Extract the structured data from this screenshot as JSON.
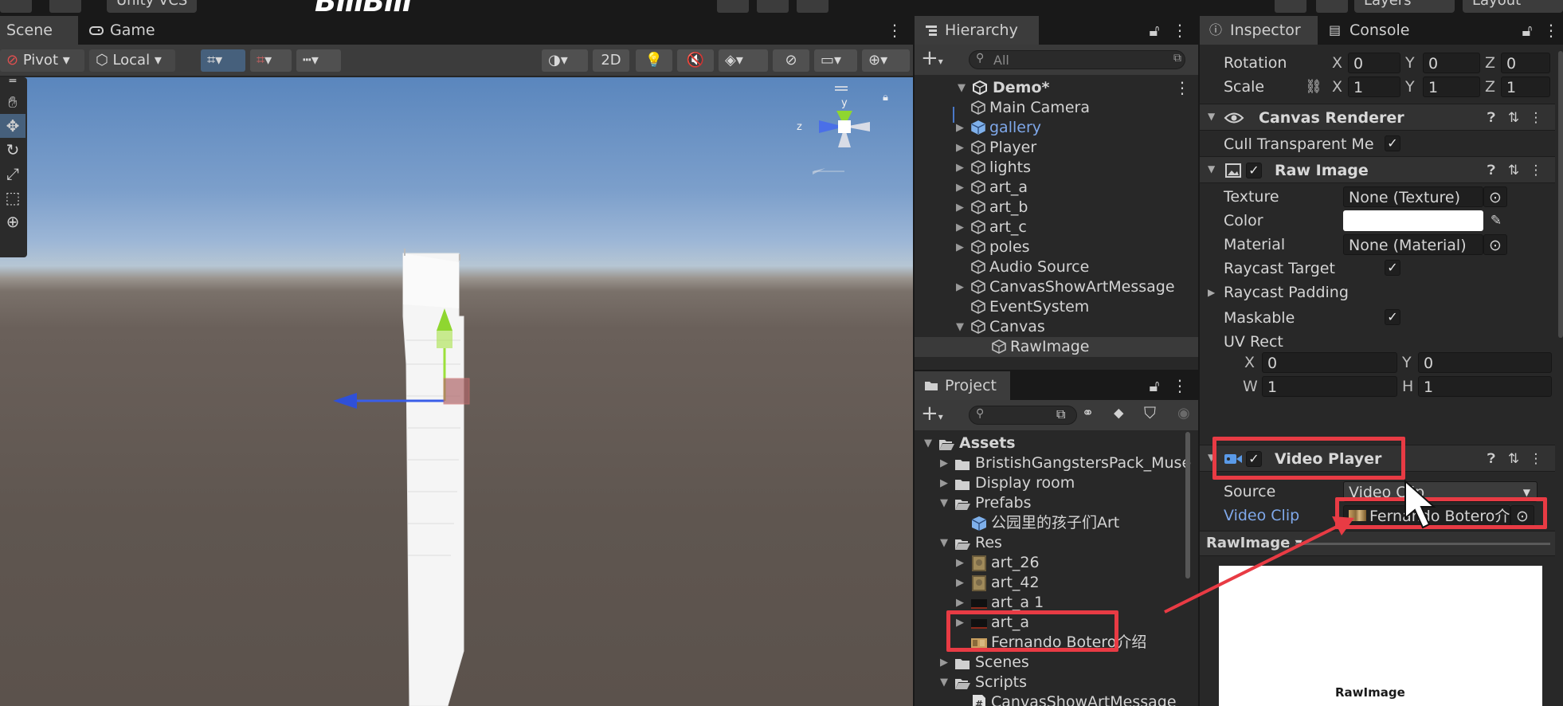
{
  "top_toolbar": {
    "vcs_label": "Unity VCS",
    "watermark": "BiliBili",
    "layers_label": "Layers",
    "layout_label": "Layout"
  },
  "scene": {
    "tabs": [
      {
        "label": "Scene",
        "icon": "grid-icon",
        "active": true
      },
      {
        "label": "Game",
        "icon": "gamepad-icon",
        "active": false
      }
    ],
    "toolbar": {
      "pivot_label": "Pivot",
      "local_label": "Local",
      "two_d_label": "2D"
    },
    "gizmo_axes": {
      "y": "y",
      "z": "z"
    }
  },
  "hierarchy": {
    "tab_label": "Hierarchy",
    "search_placeholder": "All",
    "root": "Demo*",
    "items": [
      {
        "label": "Main Camera",
        "depth": 1,
        "expandable": false,
        "selected": false,
        "prefab": false
      },
      {
        "label": "gallery",
        "depth": 1,
        "expandable": true,
        "selected": false,
        "prefab": true
      },
      {
        "label": "Player",
        "depth": 1,
        "expandable": true,
        "selected": false,
        "prefab": false
      },
      {
        "label": "lights",
        "depth": 1,
        "expandable": true,
        "selected": false,
        "prefab": false
      },
      {
        "label": "art_a",
        "depth": 1,
        "expandable": true,
        "selected": false,
        "prefab": false
      },
      {
        "label": "art_b",
        "depth": 1,
        "expandable": true,
        "selected": false,
        "prefab": false
      },
      {
        "label": "art_c",
        "depth": 1,
        "expandable": true,
        "selected": false,
        "prefab": false
      },
      {
        "label": "poles",
        "depth": 1,
        "expandable": true,
        "selected": false,
        "prefab": false
      },
      {
        "label": "Audio Source",
        "depth": 1,
        "expandable": false,
        "selected": false,
        "prefab": false
      },
      {
        "label": "CanvasShowArtMessage",
        "depth": 1,
        "expandable": true,
        "selected": false,
        "prefab": false
      },
      {
        "label": "EventSystem",
        "depth": 1,
        "expandable": false,
        "selected": false,
        "prefab": false
      },
      {
        "label": "Canvas",
        "depth": 1,
        "expandable": true,
        "expanded": true,
        "selected": false,
        "prefab": false
      },
      {
        "label": "RawImage",
        "depth": 2,
        "expandable": false,
        "selected": true,
        "prefab": false
      }
    ]
  },
  "project": {
    "tab_label": "Project",
    "items": [
      {
        "label": "Assets",
        "depth": 0,
        "kind": "folder-open",
        "arrow": "down",
        "bold": true
      },
      {
        "label": "BristishGangstersPack_Muse",
        "depth": 1,
        "kind": "folder",
        "arrow": "right"
      },
      {
        "label": "Display room",
        "depth": 1,
        "kind": "folder",
        "arrow": "right"
      },
      {
        "label": "Prefabs",
        "depth": 1,
        "kind": "folder-open",
        "arrow": "down"
      },
      {
        "label": "公园里的孩子们Art",
        "depth": 2,
        "kind": "prefab",
        "arrow": ""
      },
      {
        "label": "Res",
        "depth": 1,
        "kind": "folder-open",
        "arrow": "down"
      },
      {
        "label": "art_26",
        "depth": 2,
        "kind": "texture-art",
        "arrow": "right"
      },
      {
        "label": "art_42",
        "depth": 2,
        "kind": "texture-art",
        "arrow": "right"
      },
      {
        "label": "art_a 1",
        "depth": 2,
        "kind": "texture-dark",
        "arrow": "right"
      },
      {
        "label": "art_a",
        "depth": 2,
        "kind": "texture-dark",
        "arrow": "right"
      },
      {
        "label": "Fernando Botero介绍",
        "depth": 2,
        "kind": "video-clip",
        "arrow": ""
      },
      {
        "label": "Scenes",
        "depth": 1,
        "kind": "folder",
        "arrow": "right"
      },
      {
        "label": "Scripts",
        "depth": 1,
        "kind": "folder-open",
        "arrow": "down"
      },
      {
        "label": "CanvasShowArtMessage",
        "depth": 2,
        "kind": "script",
        "arrow": ""
      }
    ]
  },
  "inspector": {
    "tabs": [
      {
        "label": "Inspector",
        "active": true
      },
      {
        "label": "Console",
        "active": false
      }
    ],
    "transform": {
      "rotation_label": "Rotation",
      "rotation": {
        "x": "0",
        "y": "0",
        "z": "0"
      },
      "scale_label": "Scale",
      "scale": {
        "x": "1",
        "y": "1",
        "z": "1"
      }
    },
    "canvas_renderer": {
      "title": "Canvas Renderer",
      "cull_label": "Cull Transparent Me",
      "cull_checked": true
    },
    "raw_image": {
      "title": "Raw Image",
      "texture_label": "Texture",
      "texture_value": "None (Texture)",
      "color_label": "Color",
      "color_value": "#ffffff",
      "material_label": "Material",
      "material_value": "None (Material)",
      "raycast_target_label": "Raycast Target",
      "raycast_padding_label": "Raycast Padding",
      "maskable_label": "Maskable",
      "uv_rect_label": "UV Rect",
      "uv": {
        "x_label": "X",
        "x": "0",
        "y_label": "Y",
        "y": "0",
        "w_label": "W",
        "w": "1",
        "h_label": "H",
        "h": "1"
      }
    },
    "video_player": {
      "title": "Video Player",
      "source_label": "Source",
      "source_value": "Video Clip",
      "video_clip_label": "Video Clip",
      "video_clip_value": "Fernando Botero介"
    },
    "preview": {
      "dropdown_label": "RawImage ▾",
      "caption": "RawImage"
    }
  },
  "colors": {
    "accent_selection": "#3a3a3a",
    "highlight_box": "#e83b44",
    "link_blue": "#7fa8ea"
  }
}
